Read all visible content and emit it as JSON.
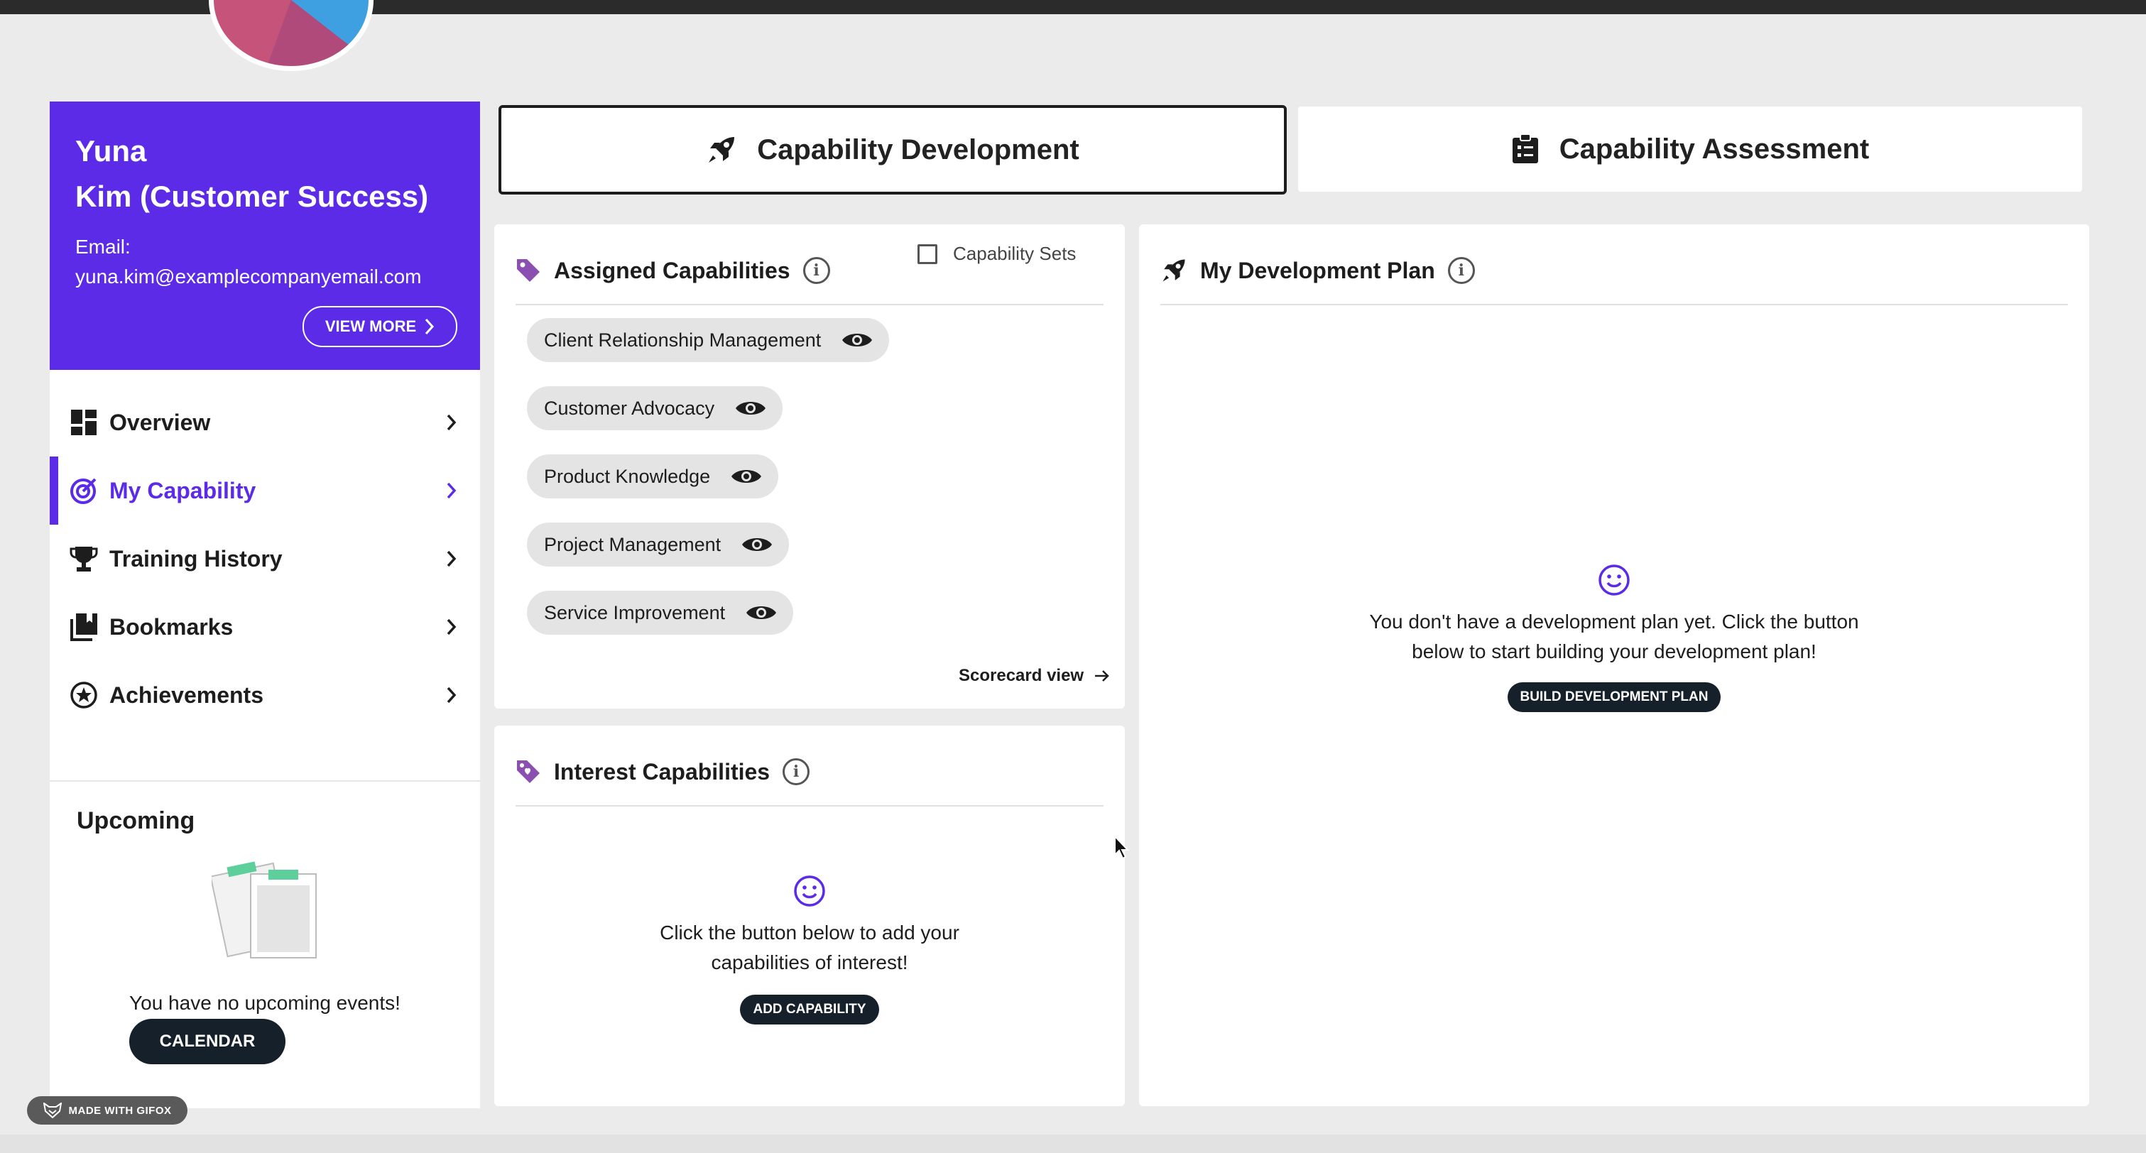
{
  "profile": {
    "first_name": "Yuna",
    "last_name_role": "Kim (Customer Success)",
    "email_label": "Email:",
    "email": "yuna.kim@examplecompanyemail.com",
    "view_more_label": "VIEW MORE"
  },
  "nav": {
    "overview": "Overview",
    "my_capability": "My Capability",
    "training_history": "Training History",
    "bookmarks": "Bookmarks",
    "achievements": "Achievements",
    "active": "My Capability"
  },
  "upcoming": {
    "title": "Upcoming",
    "empty_text": "You have no upcoming events!",
    "calendar_label": "CALENDAR"
  },
  "tabs": {
    "development": "Capability Development",
    "assessment": "Capability Assessment",
    "selected": "Capability Development"
  },
  "assigned": {
    "title": "Assigned Capabilities",
    "capability_sets_label": "Capability Sets",
    "capability_sets_checked": false,
    "items": [
      "Client Relationship Management",
      "Customer Advocacy",
      "Product Knowledge",
      "Project Management",
      "Service Improvement"
    ],
    "scorecard_label": "Scorecard view"
  },
  "interest": {
    "title": "Interest Capabilities",
    "empty_line1": "Click the button below to add your",
    "empty_line2": "capabilities of interest!",
    "button_label": "ADD CAPABILITY"
  },
  "devplan": {
    "title": "My Development Plan",
    "empty_line1": "You don't have a development plan yet. Click the button",
    "empty_line2": "below to start building your development plan!",
    "button_label": "BUILD DEVELOPMENT PLAN"
  },
  "watermark": {
    "label": "MADE WITH GIFOX"
  },
  "colors": {
    "accent": "#5b2be8",
    "dark": "#16202a",
    "background": "#ebebeb",
    "tag_purple": "#8a4fb0"
  },
  "icons": {
    "tab_development": "rocket-icon",
    "tab_assessment": "clipboard-icon",
    "assigned": "tag-icon",
    "interest": "heart-tag-icon",
    "devplan": "rocket-icon",
    "chip": "eye-icon",
    "empty_state": "smiley-icon"
  }
}
